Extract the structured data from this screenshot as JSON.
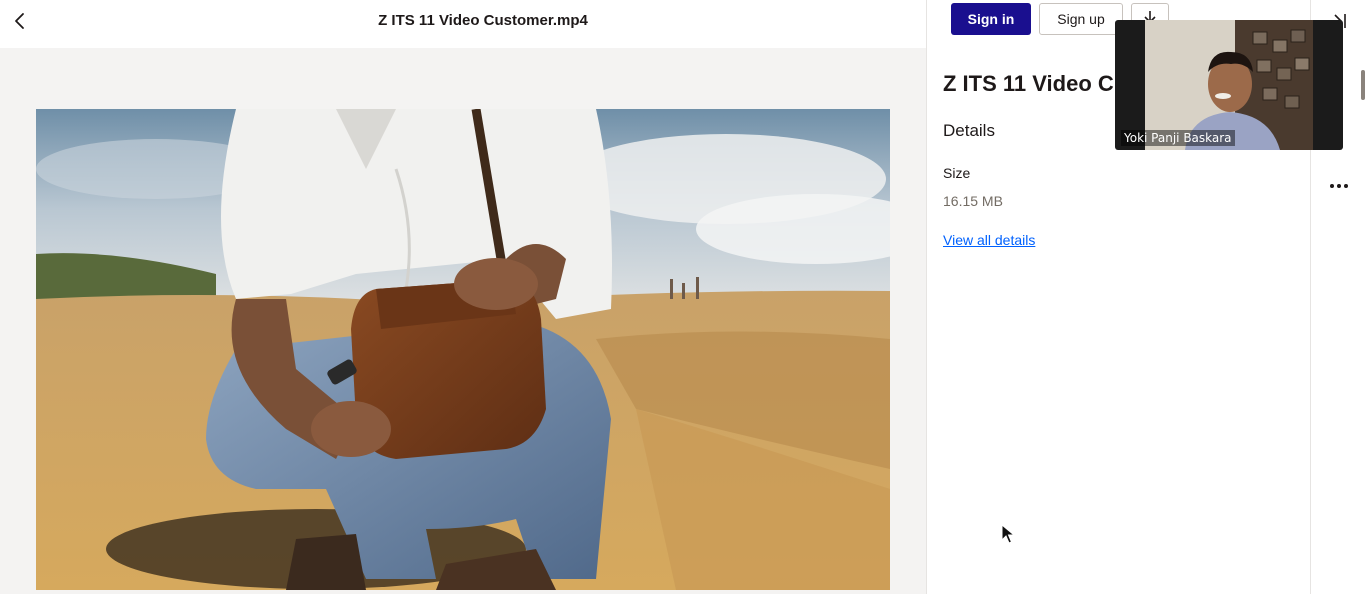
{
  "header": {
    "file_name": "Z ITS 11 Video Customer.mp4"
  },
  "auth": {
    "sign_in_label": "Sign in",
    "sign_up_label": "Sign up"
  },
  "details_panel": {
    "title": "Z ITS 11 Video Customer.mp4",
    "section_heading": "Details",
    "size_label": "Size",
    "size_value": "16.15 MB",
    "view_all_label": "View all details"
  },
  "participant": {
    "name": "Yoki Panji Baskara"
  },
  "icons": {
    "back": "chevron-left-icon",
    "download": "download-icon",
    "collapse": "collapse-panel-icon",
    "more": "more-horizontal-icon"
  },
  "colors": {
    "primary": "#1a0f8f",
    "link": "#0061fe",
    "secondary_text": "#736c64",
    "viewer_background": "#f4f3f2"
  }
}
